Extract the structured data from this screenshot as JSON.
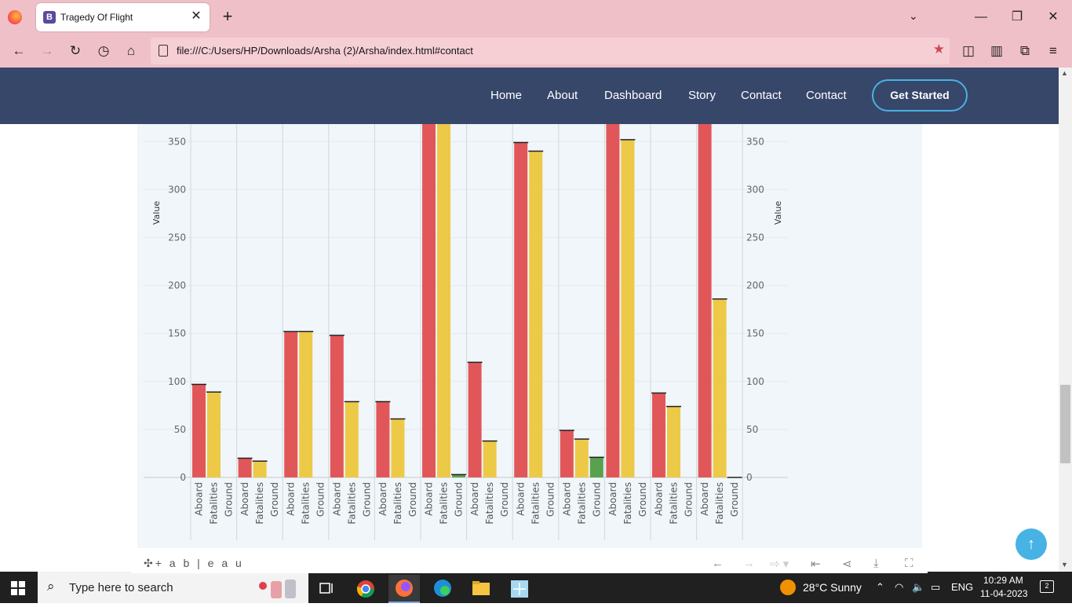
{
  "browser": {
    "tab_title": "Tragedy Of Flight",
    "tab_favicon_letter": "B",
    "url": "file:///C:/Users/HP/Downloads/Arsha (2)/Arsha/index.html#contact"
  },
  "site": {
    "nav": [
      "Home",
      "About",
      "Dashboard",
      "Story",
      "Contact",
      "Contact"
    ],
    "cta": "Get Started"
  },
  "tableau": {
    "logo": "+ a b | e a u"
  },
  "taskbar": {
    "search_placeholder": "Type here to search",
    "weather": "28°C  Sunny",
    "language": "ENG",
    "time": "10:29 AM",
    "date": "11-04-2023",
    "notification_count": "2"
  },
  "colors": {
    "aboard": "#e15759",
    "fatalities": "#edc948",
    "ground": "#59a14f",
    "header": "#37476a",
    "accent": "#47b2e4"
  },
  "chart_data": {
    "type": "bar",
    "ylabel": "Value",
    "ylabel_right": "Value",
    "ylim": [
      0,
      400
    ],
    "yticks": [
      0,
      50,
      100,
      150,
      200,
      250,
      300,
      350,
      400
    ],
    "measures": [
      "Aboard",
      "Fatalities",
      "Ground"
    ],
    "groups": [
      {
        "Aboard": 97,
        "Fatalities": 89,
        "Ground": 0
      },
      {
        "Aboard": 20,
        "Fatalities": 17,
        "Ground": 0
      },
      {
        "Aboard": 152,
        "Fatalities": 152,
        "Ground": 0
      },
      {
        "Aboard": 148,
        "Fatalities": 79,
        "Ground": 0
      },
      {
        "Aboard": 79,
        "Fatalities": 61,
        "Ground": 0
      },
      {
        "Aboard": 420,
        "Fatalities": 420,
        "Ground": 3
      },
      {
        "Aboard": 120,
        "Fatalities": 38,
        "Ground": 0
      },
      {
        "Aboard": 349,
        "Fatalities": 340,
        "Ground": 0
      },
      {
        "Aboard": 49,
        "Fatalities": 40,
        "Ground": 21
      },
      {
        "Aboard": 390,
        "Fatalities": 352,
        "Ground": 0
      },
      {
        "Aboard": 88,
        "Fatalities": 74,
        "Ground": 0
      },
      {
        "Aboard": 389,
        "Fatalities": 186,
        "Ground": 0
      }
    ]
  }
}
